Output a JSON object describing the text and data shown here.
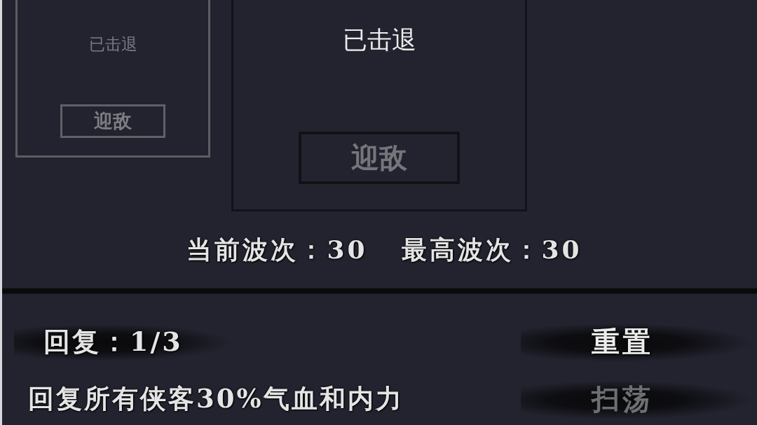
{
  "stage_cards": [
    {
      "status": "已击退",
      "button": "迎敌",
      "selected": false
    },
    {
      "status": "已击退",
      "button": "迎敌",
      "selected": true
    }
  ],
  "wave_info": [
    "当前波次：30",
    "最高波次：30"
  ],
  "recovery": {
    "count": "回复：1/3",
    "description": "回复所有侠客30%气血和内力"
  },
  "actions": [
    {
      "label": "重置",
      "disabled": false
    },
    {
      "label": "扫荡",
      "disabled": true
    }
  ]
}
